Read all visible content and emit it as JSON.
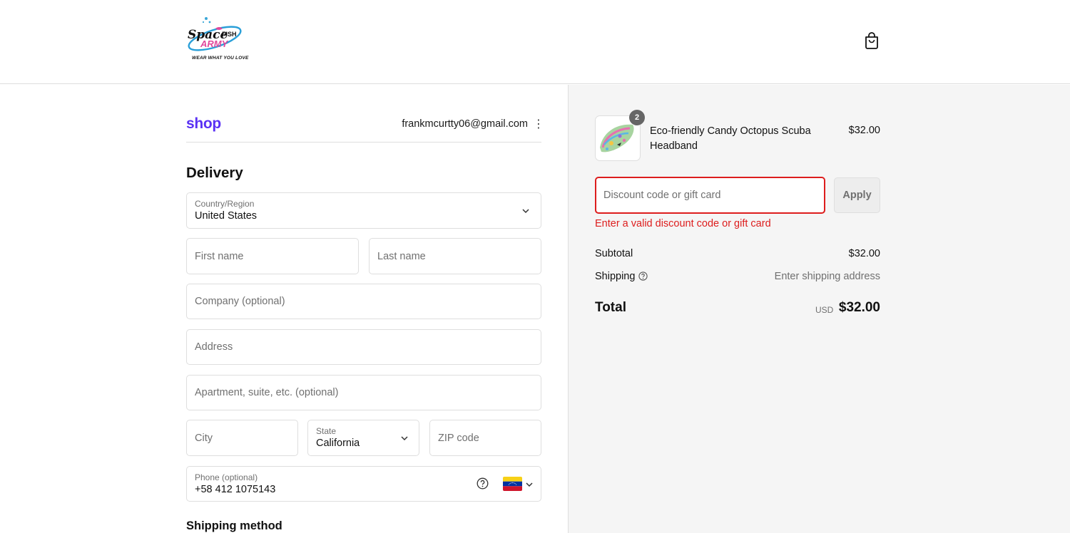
{
  "header": {
    "logo_text": "SpaceFISH ARMY",
    "logo_tagline": "WEAR WHAT YOU LOVE",
    "cart_icon": "shopping-bag-icon"
  },
  "account": {
    "shop_brand": "shop",
    "email": "frankmcurtty06@gmail.com",
    "menu_icon": "kebab-menu-icon"
  },
  "delivery": {
    "heading": "Delivery",
    "country": {
      "label": "Country/Region",
      "value": "United States"
    },
    "first_name": {
      "placeholder": "First name"
    },
    "last_name": {
      "placeholder": "Last name"
    },
    "company": {
      "placeholder": "Company (optional)"
    },
    "address": {
      "placeholder": "Address"
    },
    "apartment": {
      "placeholder": "Apartment, suite, etc. (optional)"
    },
    "city": {
      "placeholder": "City"
    },
    "state": {
      "label": "State",
      "value": "California"
    },
    "zip": {
      "placeholder": "ZIP code"
    },
    "phone": {
      "label": "Phone (optional)",
      "value": "+58 412 1075143",
      "country_flag": "venezuela-flag-icon"
    }
  },
  "shipping_method": {
    "heading": "Shipping method"
  },
  "summary": {
    "item": {
      "name": "Eco-friendly Candy Octopus Scuba Headband",
      "price": "$32.00",
      "quantity": "2"
    },
    "discount": {
      "placeholder": "Discount code or gift card",
      "apply_label": "Apply",
      "error": "Enter a valid discount code or gift card"
    },
    "subtotal_label": "Subtotal",
    "subtotal_value": "$32.00",
    "shipping_label": "Shipping",
    "shipping_value": "Enter shipping address",
    "total_label": "Total",
    "total_currency": "USD",
    "total_value": "$32.00"
  },
  "colors": {
    "accent_shop": "#5a31f4",
    "error": "#dd1d1d",
    "border": "#dedede",
    "summary_bg": "#f5f5f5"
  }
}
